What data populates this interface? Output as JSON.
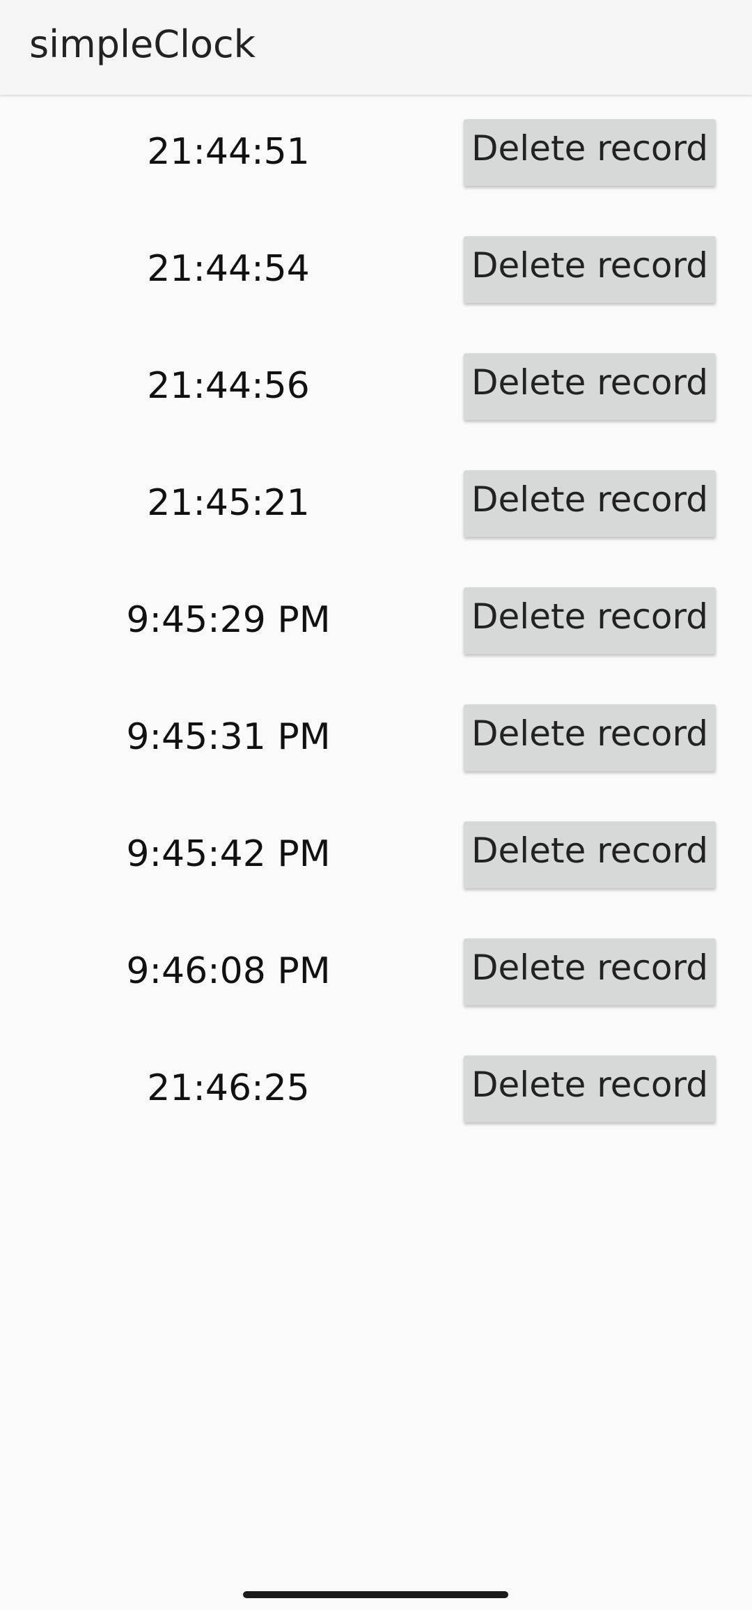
{
  "app": {
    "title": "simpleClock"
  },
  "records": [
    {
      "time": "21:44:51",
      "delete_label": "Delete record"
    },
    {
      "time": "21:44:54",
      "delete_label": "Delete record"
    },
    {
      "time": "21:44:56",
      "delete_label": "Delete record"
    },
    {
      "time": "21:45:21",
      "delete_label": "Delete record"
    },
    {
      "time": "9:45:29 PM",
      "delete_label": "Delete record"
    },
    {
      "time": "9:45:31 PM",
      "delete_label": "Delete record"
    },
    {
      "time": "9:45:42 PM",
      "delete_label": "Delete record"
    },
    {
      "time": "9:46:08 PM",
      "delete_label": "Delete record"
    },
    {
      "time": "21:46:25",
      "delete_label": "Delete record"
    }
  ],
  "colors": {
    "background": "#fafafa",
    "app_bar": "#f5f5f5",
    "button": "#d7d8d8",
    "text": "#111111"
  }
}
